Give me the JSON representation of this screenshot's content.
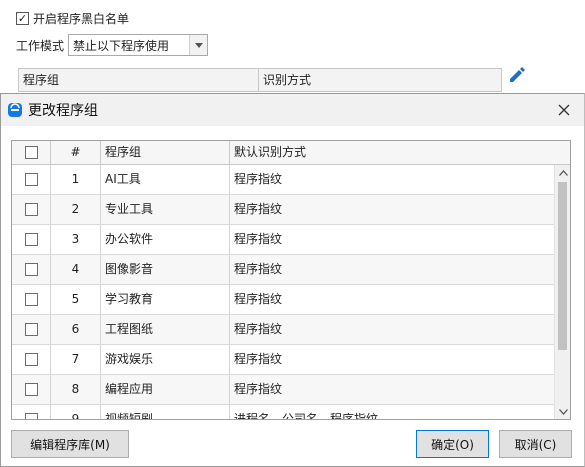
{
  "background": {
    "blacklist_checkbox": {
      "label": "开启程序黑白名单",
      "checked": true,
      "check_glyph": "✓"
    },
    "work_mode": {
      "label": "工作模式",
      "selected": "禁止以下程序使用"
    },
    "table_headers": [
      "程序组",
      "识别方式"
    ],
    "edit_icon": "pencil-icon",
    "accent_color": "#1e6fc2"
  },
  "dialog": {
    "title": "更改程序组",
    "icon": "app-logo-icon",
    "close_icon": "close-icon",
    "columns": {
      "num": "#",
      "group": "程序组",
      "mode": "默认识别方式"
    },
    "rows": [
      {
        "num": "1",
        "group": "AI工具",
        "mode": "程序指纹"
      },
      {
        "num": "2",
        "group": "专业工具",
        "mode": "程序指纹"
      },
      {
        "num": "3",
        "group": "办公软件",
        "mode": "程序指纹"
      },
      {
        "num": "4",
        "group": "图像影音",
        "mode": "程序指纹"
      },
      {
        "num": "5",
        "group": "学习教育",
        "mode": "程序指纹"
      },
      {
        "num": "6",
        "group": "工程图纸",
        "mode": "程序指纹"
      },
      {
        "num": "7",
        "group": "游戏娱乐",
        "mode": "程序指纹"
      },
      {
        "num": "8",
        "group": "编程应用",
        "mode": "程序指纹"
      },
      {
        "num": "9",
        "group": "视频短剧",
        "mode": "进程名、公司名、程序指纹"
      }
    ],
    "buttons": {
      "edit_library": "编辑程序库(M)",
      "ok": "确定(O)",
      "cancel": "取消(C)"
    },
    "title_bar_color": "#f1f1f1"
  }
}
